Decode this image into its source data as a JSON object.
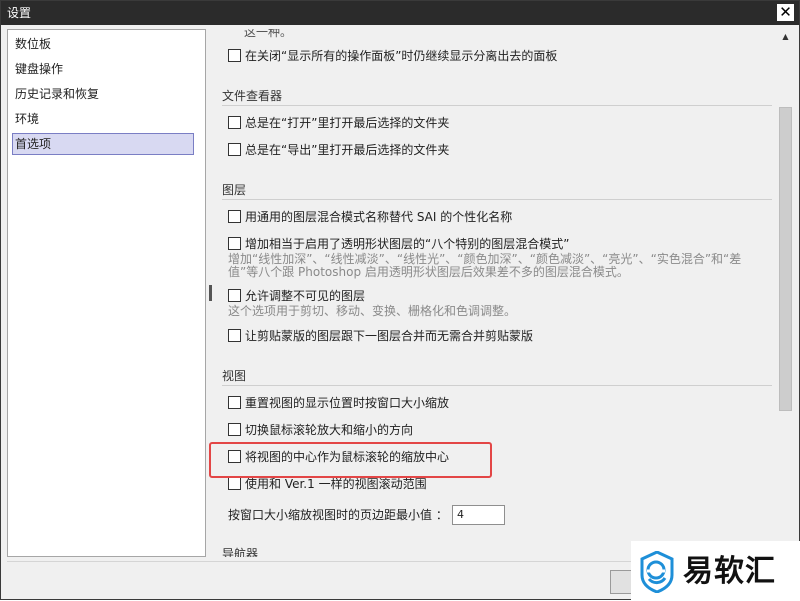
{
  "window": {
    "title": "设置",
    "close_glyph": "✕"
  },
  "sidebar": {
    "items": [
      {
        "label": "数位板"
      },
      {
        "label": "键盘操作"
      },
      {
        "label": "历史记录和恢复"
      },
      {
        "label": "环境"
      },
      {
        "label": "首选项",
        "selected": true
      }
    ]
  },
  "content": {
    "cut_top_text": "这一种。",
    "top_option": "在关闭“显示所有的操作面板”时仍继续显示分离出去的面板",
    "sections": {
      "file_viewer": {
        "title": "文件查看器",
        "options": [
          "总是在“打开”里打开最后选择的文件夹",
          "总是在“导出”里打开最后选择的文件夹"
        ]
      },
      "layers": {
        "title": "图层",
        "opt1": "用通用的图层混合模式名称替代 SAI 的个性化名称",
        "opt2": "增加相当于启用了透明形状图层的“八个特别的图层混合模式”",
        "opt2_desc": "增加“线性加深”、“线性减淡”、“线性光”、“颜色加深”、“颜色减淡”、“亮光”、“实色混合”和“差值”等八个跟 Photoshop 启用透明形状图层后效果差不多的图层混合模式。",
        "opt3": "允许调整不可见的图层",
        "opt3_desc": "这个选项用于剪切、移动、变换、栅格化和色调调整。",
        "opt4": "让剪贴蒙版的图层跟下一图层合并而无需合并剪贴蒙版"
      },
      "view": {
        "title": "视图",
        "options": [
          "重置视图的显示位置时按窗口大小缩放",
          "切换鼠标滚轮放大和缩小的方向",
          "将视图的中心作为鼠标滚轮的缩放中心",
          "使用和 Ver.1 一样的视图滚动范围"
        ],
        "margin_label": "按窗口大小缩放视图时的页边距最小值 ：",
        "margin_value": "4"
      },
      "navigator": {
        "title": "导航器"
      }
    }
  },
  "watermark": {
    "text": "易软汇",
    "icon": "yiruanhui-logo-icon"
  },
  "colors": {
    "titlebar": "#2b2b2b",
    "selected_item_bg": "#d8d9f2",
    "selected_item_border": "#7a7ec4",
    "highlight_box": "#e34646",
    "description_text": "#8a8a8a"
  }
}
